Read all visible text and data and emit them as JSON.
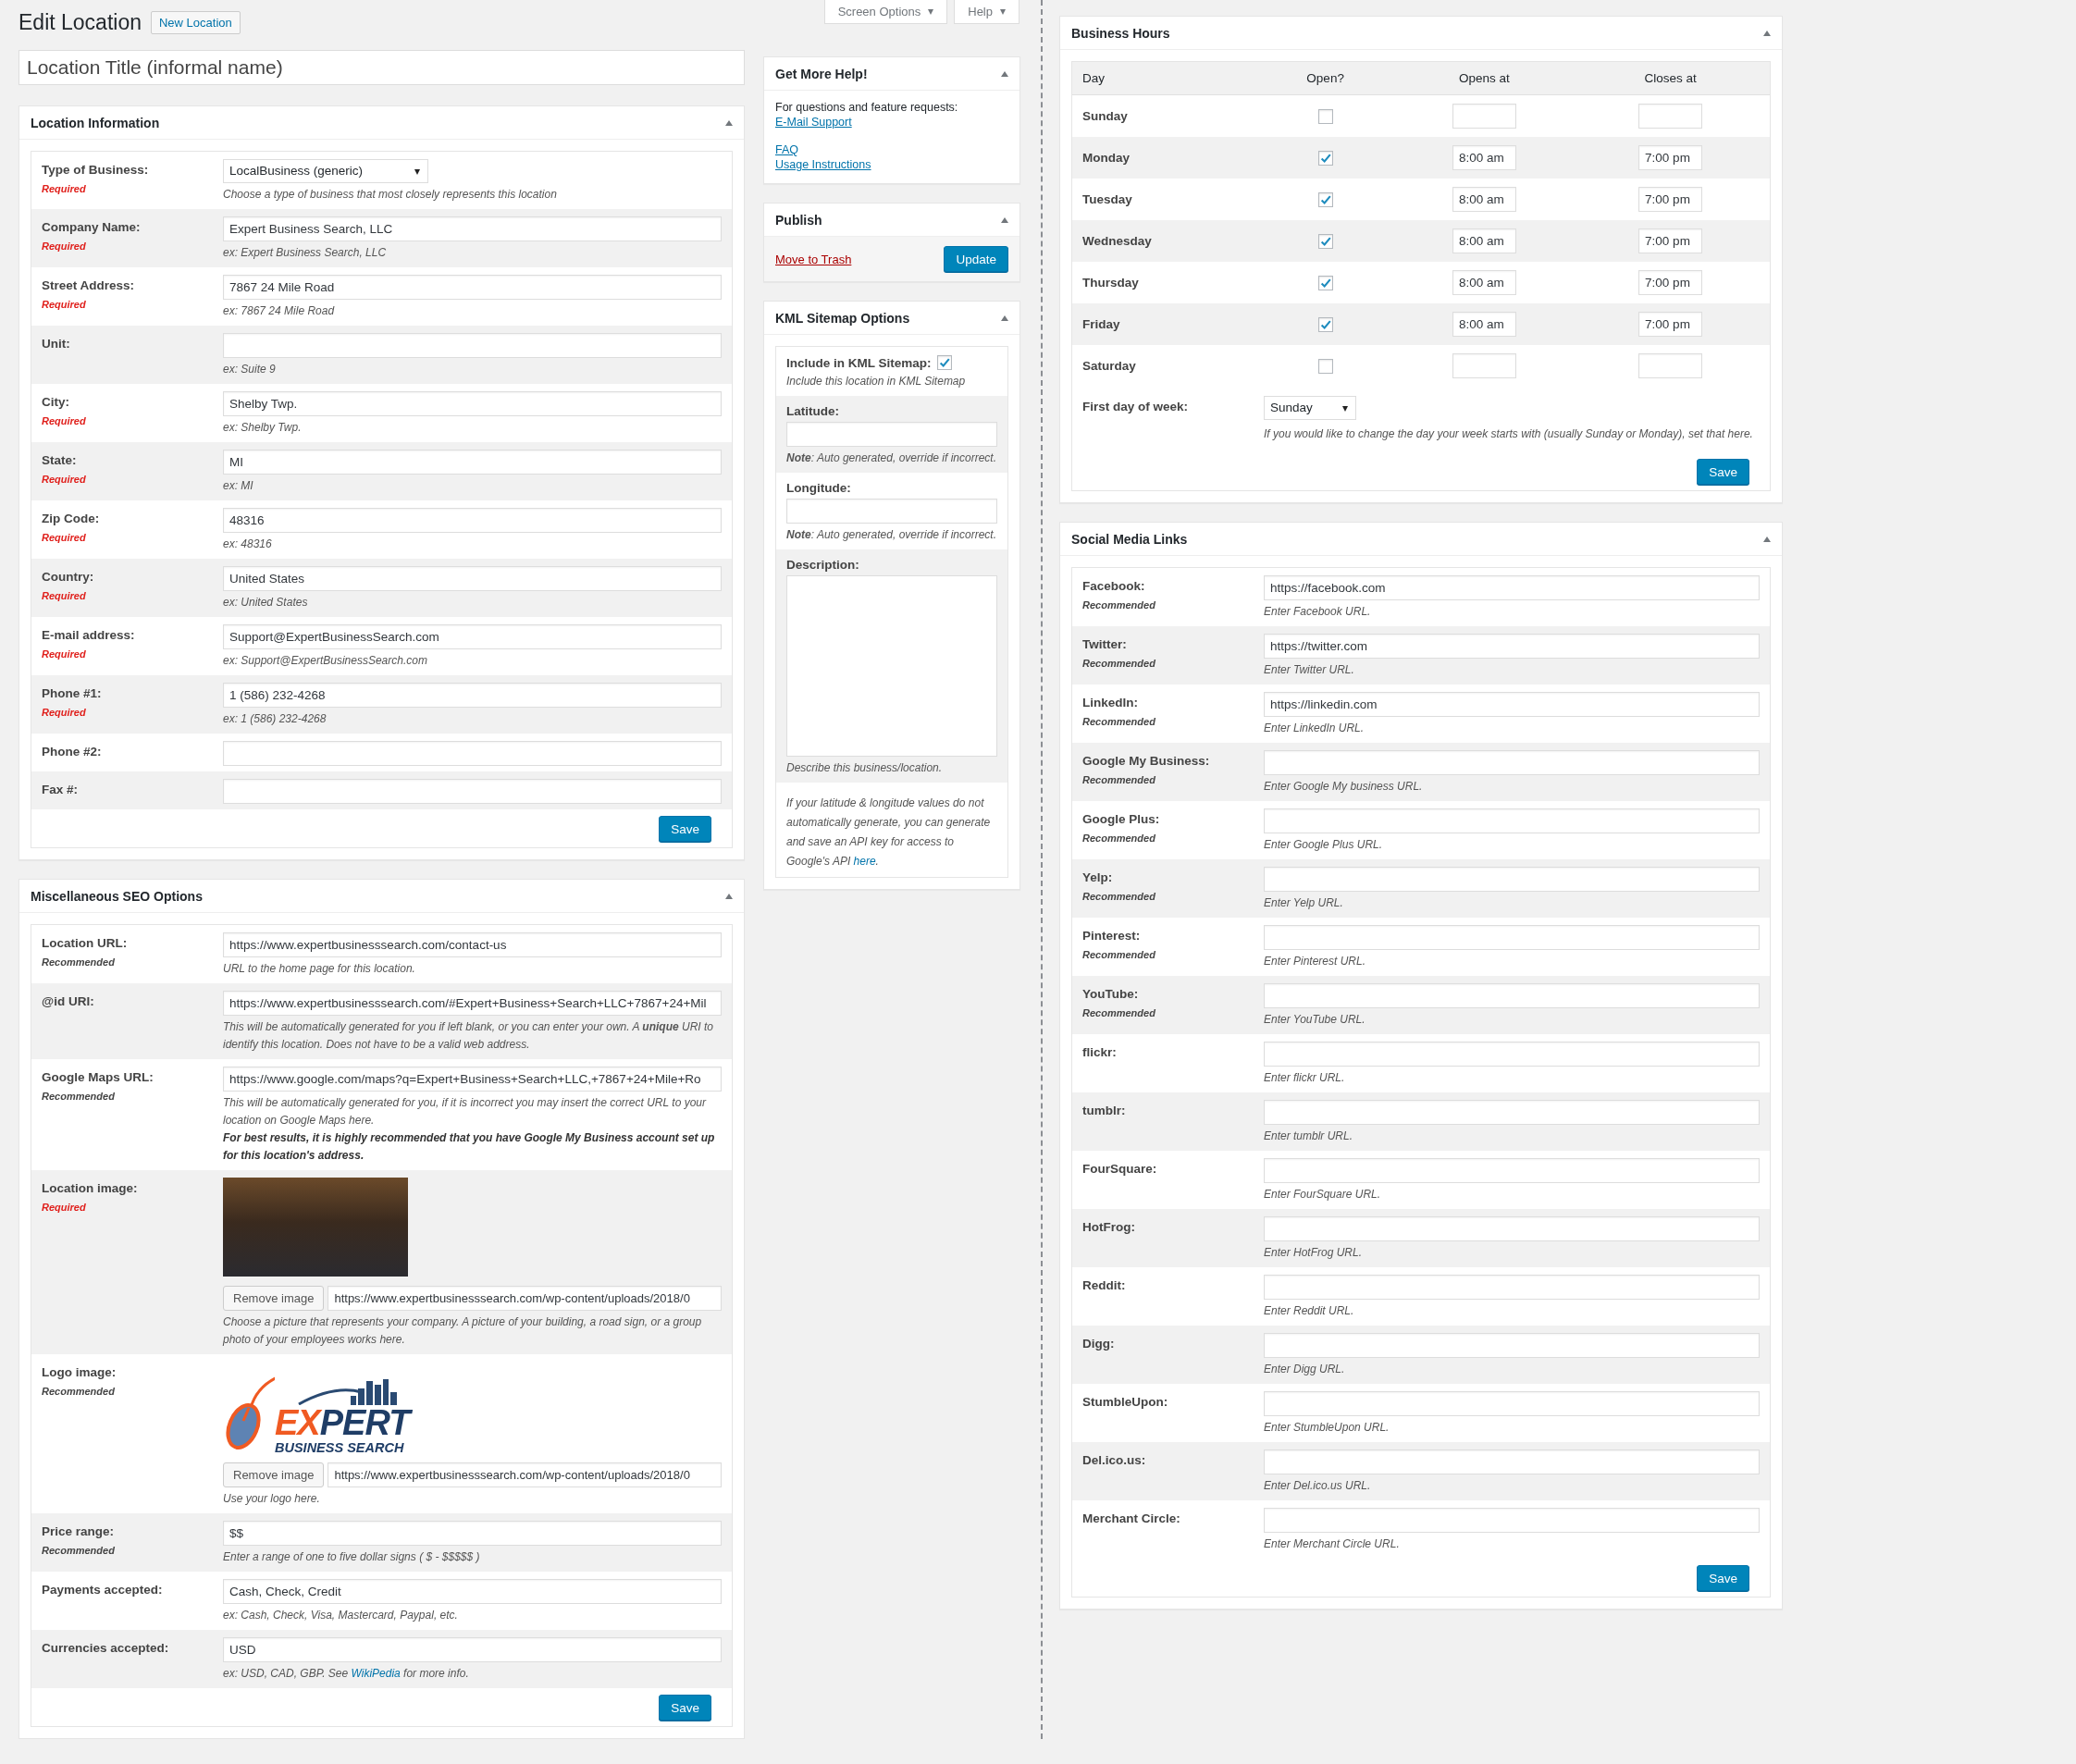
{
  "header": {
    "title": "Edit Location",
    "new_button": "New Location"
  },
  "screen_tabs": [
    {
      "label": "Screen Options"
    },
    {
      "label": "Help"
    }
  ],
  "title_field": {
    "placeholder": "Location Title (informal name)"
  },
  "location_info": {
    "title": "Location Information",
    "save": "Save",
    "rows": [
      {
        "kind": "select",
        "label": "Type of Business:",
        "note": "Required",
        "required": true,
        "value": "LocalBusiness (generic)",
        "hint": "Choose a type of business that most closely represents this location"
      },
      {
        "kind": "text",
        "label": "Company Name:",
        "note": "Required",
        "required": true,
        "value": "Expert Business Search, LLC",
        "hint": "ex: Expert Business Search, LLC"
      },
      {
        "kind": "text",
        "label": "Street Address:",
        "note": "Required",
        "required": true,
        "value": "7867 24 Mile Road",
        "hint": "ex: 7867 24 Mile Road"
      },
      {
        "kind": "text",
        "label": "Unit:",
        "hint": "ex: Suite 9"
      },
      {
        "kind": "text",
        "label": "City:",
        "note": "Required",
        "required": true,
        "value": "Shelby Twp.",
        "hint": "ex: Shelby Twp."
      },
      {
        "kind": "text",
        "label": "State:",
        "note": "Required",
        "required": true,
        "value": "MI",
        "hint": "ex: MI"
      },
      {
        "kind": "text",
        "label": "Zip Code:",
        "note": "Required",
        "required": true,
        "value": "48316",
        "hint": "ex: 48316"
      },
      {
        "kind": "text",
        "label": "Country:",
        "note": "Required",
        "required": true,
        "value": "United States",
        "hint": "ex: United States"
      },
      {
        "kind": "text",
        "label": "E-mail address:",
        "note": "Required",
        "required": true,
        "value": "Support@ExpertBusinessSearch.com",
        "hint": "ex: Support@ExpertBusinessSearch.com"
      },
      {
        "kind": "text",
        "label": "Phone #1:",
        "note": "Required",
        "required": true,
        "value": "1 (586) 232-4268",
        "hint": "ex: 1 (586) 232-4268"
      },
      {
        "kind": "text",
        "label": "Phone #2:"
      },
      {
        "kind": "text",
        "label": "Fax #:"
      }
    ]
  },
  "seo": {
    "title": "Miscellaneous SEO Options",
    "save": "Save",
    "rows": [
      {
        "kind": "text",
        "label": "Location URL:",
        "note": "Recommended",
        "required": false,
        "value": "https://www.expertbusinesssearch.com/contact-us",
        "hint": "URL to the home page for this location."
      },
      {
        "kind": "text",
        "label": "@id URI:",
        "value": "https://www.expertbusinesssearch.com/#Expert+Business+Search+LLC+7867+24+Mil",
        "hint": "This will be automatically generated for you if left blank, or you can enter your own. A **unique** URI to identify this location. Does not have to be a valid web address."
      },
      {
        "kind": "text",
        "label": "Google Maps URL:",
        "note": "Recommended",
        "required": false,
        "value": "https://www.google.com/maps?q=Expert+Business+Search+LLC,+7867+24+Mile+Ro",
        "hint": "This will be automatically generated for you, if it is incorrect you may insert the correct URL to your location on Google Maps here.",
        "notice": "For best results, it is highly recommended that you have Google My Business account set up for this location's address."
      },
      {
        "kind": "photo",
        "label": "Location image:",
        "note": "Required",
        "required": true,
        "button": "Remove image",
        "value": "https://www.expertbusinesssearch.com/wp-content/uploads/2018/0",
        "hint": "Choose a picture that represents your company. A picture of your building, a road sign, or a group photo of your employees works here."
      },
      {
        "kind": "logo",
        "label": "Logo image:",
        "note": "Recommended",
        "required": false,
        "logo": {
          "accent": "EX",
          "main": "PERT",
          "tagline": "BUSINESS SEARCH"
        },
        "button": "Remove image",
        "value": "https://www.expertbusinesssearch.com/wp-content/uploads/2018/0",
        "hint": "Use your logo here."
      },
      {
        "kind": "text",
        "label": "Price range:",
        "note": "Recommended",
        "required": false,
        "value": "$$",
        "hint": "Enter a range of one to five dollar signs ( $ - $$$$$ )"
      },
      {
        "kind": "text",
        "label": "Payments accepted:",
        "value": "Cash, Check, Credit",
        "hint": "ex: Cash, Check, Visa, Mastercard, Paypal, etc."
      },
      {
        "kind": "text",
        "label": "Currencies accepted:",
        "value": "USD",
        "hint": "ex: USD, CAD, GBP. See ",
        "hint_link": "WikiPedia",
        "hint_after": " for more info."
      }
    ]
  },
  "help": {
    "title": "Get More Help!",
    "intro": "For questions and feature requests:",
    "primary_link": "E-Mail Support",
    "links": [
      "FAQ",
      "Usage Instructions"
    ]
  },
  "publish": {
    "title": "Publish",
    "trash": "Move to Trash",
    "update": "Update"
  },
  "kml": {
    "title": "KML Sitemap Options",
    "include": {
      "label": "Include in KML Sitemap:",
      "checked": true,
      "hint": "Include this location in KML Sitemap"
    },
    "fields": [
      {
        "kind": "text",
        "label": "Latitude:",
        "hint": "**Note**: Auto generated, override if incorrect."
      },
      {
        "kind": "text",
        "label": "Longitude:",
        "hint": "**Note**: Auto generated, override if incorrect."
      },
      {
        "kind": "textarea",
        "label": "Description:",
        "hint": "Describe this business/location."
      }
    ],
    "footer": "If your latitude & longitude values do not automatically generate, you can generate and save an API key for access to Google's API ",
    "footer_link": "here",
    "footer_after": "."
  },
  "hours": {
    "title": "Business Hours",
    "columns": [
      "Day",
      "Open?",
      "Opens at",
      "Closes at"
    ],
    "days": [
      {
        "day": "Sunday",
        "open": false
      },
      {
        "day": "Monday",
        "open": true,
        "opens": "8:00 am",
        "closes": "7:00 pm"
      },
      {
        "day": "Tuesday",
        "open": true,
        "opens": "8:00 am",
        "closes": "7:00 pm"
      },
      {
        "day": "Wednesday",
        "open": true,
        "opens": "8:00 am",
        "closes": "7:00 pm"
      },
      {
        "day": "Thursday",
        "open": true,
        "opens": "8:00 am",
        "closes": "7:00 pm"
      },
      {
        "day": "Friday",
        "open": true,
        "opens": "8:00 am",
        "closes": "7:00 pm"
      },
      {
        "day": "Saturday",
        "open": false
      }
    ],
    "first_day": {
      "label": "First day of week:",
      "value": "Sunday",
      "hint": "If you would like to change the day your week starts with (usually Sunday or Monday), set that here."
    },
    "save": "Save"
  },
  "social": {
    "title": "Social Media Links",
    "save": "Save",
    "rows": [
      {
        "kind": "text",
        "label": "Facebook:",
        "note": "Recommended",
        "required": false,
        "value": "https://facebook.com",
        "hint": "Enter Facebook URL."
      },
      {
        "kind": "text",
        "label": "Twitter:",
        "note": "Recommended",
        "required": false,
        "value": "https://twitter.com",
        "hint": "Enter Twitter URL."
      },
      {
        "kind": "text",
        "label": "LinkedIn:",
        "note": "Recommended",
        "required": false,
        "value": "https://linkedin.com",
        "hint": "Enter LinkedIn URL."
      },
      {
        "kind": "text",
        "label": "Google My Business:",
        "note": "Recommended",
        "required": false,
        "hint": "Enter Google My business URL."
      },
      {
        "kind": "text",
        "label": "Google Plus:",
        "note": "Recommended",
        "required": false,
        "hint": "Enter Google Plus URL."
      },
      {
        "kind": "text",
        "label": "Yelp:",
        "note": "Recommended",
        "required": false,
        "hint": "Enter Yelp URL."
      },
      {
        "kind": "text",
        "label": "Pinterest:",
        "note": "Recommended",
        "required": false,
        "hint": "Enter Pinterest URL."
      },
      {
        "kind": "text",
        "label": "YouTube:",
        "note": "Recommended",
        "required": false,
        "hint": "Enter YouTube URL."
      },
      {
        "kind": "text",
        "label": "flickr:",
        "hint": "Enter flickr URL."
      },
      {
        "kind": "text",
        "label": "tumblr:",
        "hint": "Enter tumblr URL."
      },
      {
        "kind": "text",
        "label": "FourSquare:",
        "hint": "Enter FourSquare URL."
      },
      {
        "kind": "text",
        "label": "HotFrog:",
        "hint": "Enter HotFrog URL."
      },
      {
        "kind": "text",
        "label": "Reddit:",
        "hint": "Enter Reddit URL."
      },
      {
        "kind": "text",
        "label": "Digg:",
        "hint": "Enter Digg URL."
      },
      {
        "kind": "text",
        "label": "StumbleUpon:",
        "hint": "Enter StumbleUpon URL."
      },
      {
        "kind": "text",
        "label": "Del.ico.us:",
        "hint": "Enter Del.ico.us URL."
      },
      {
        "kind": "text",
        "label": "Merchant Circle:",
        "hint": "Enter Merchant Circle URL."
      }
    ]
  }
}
